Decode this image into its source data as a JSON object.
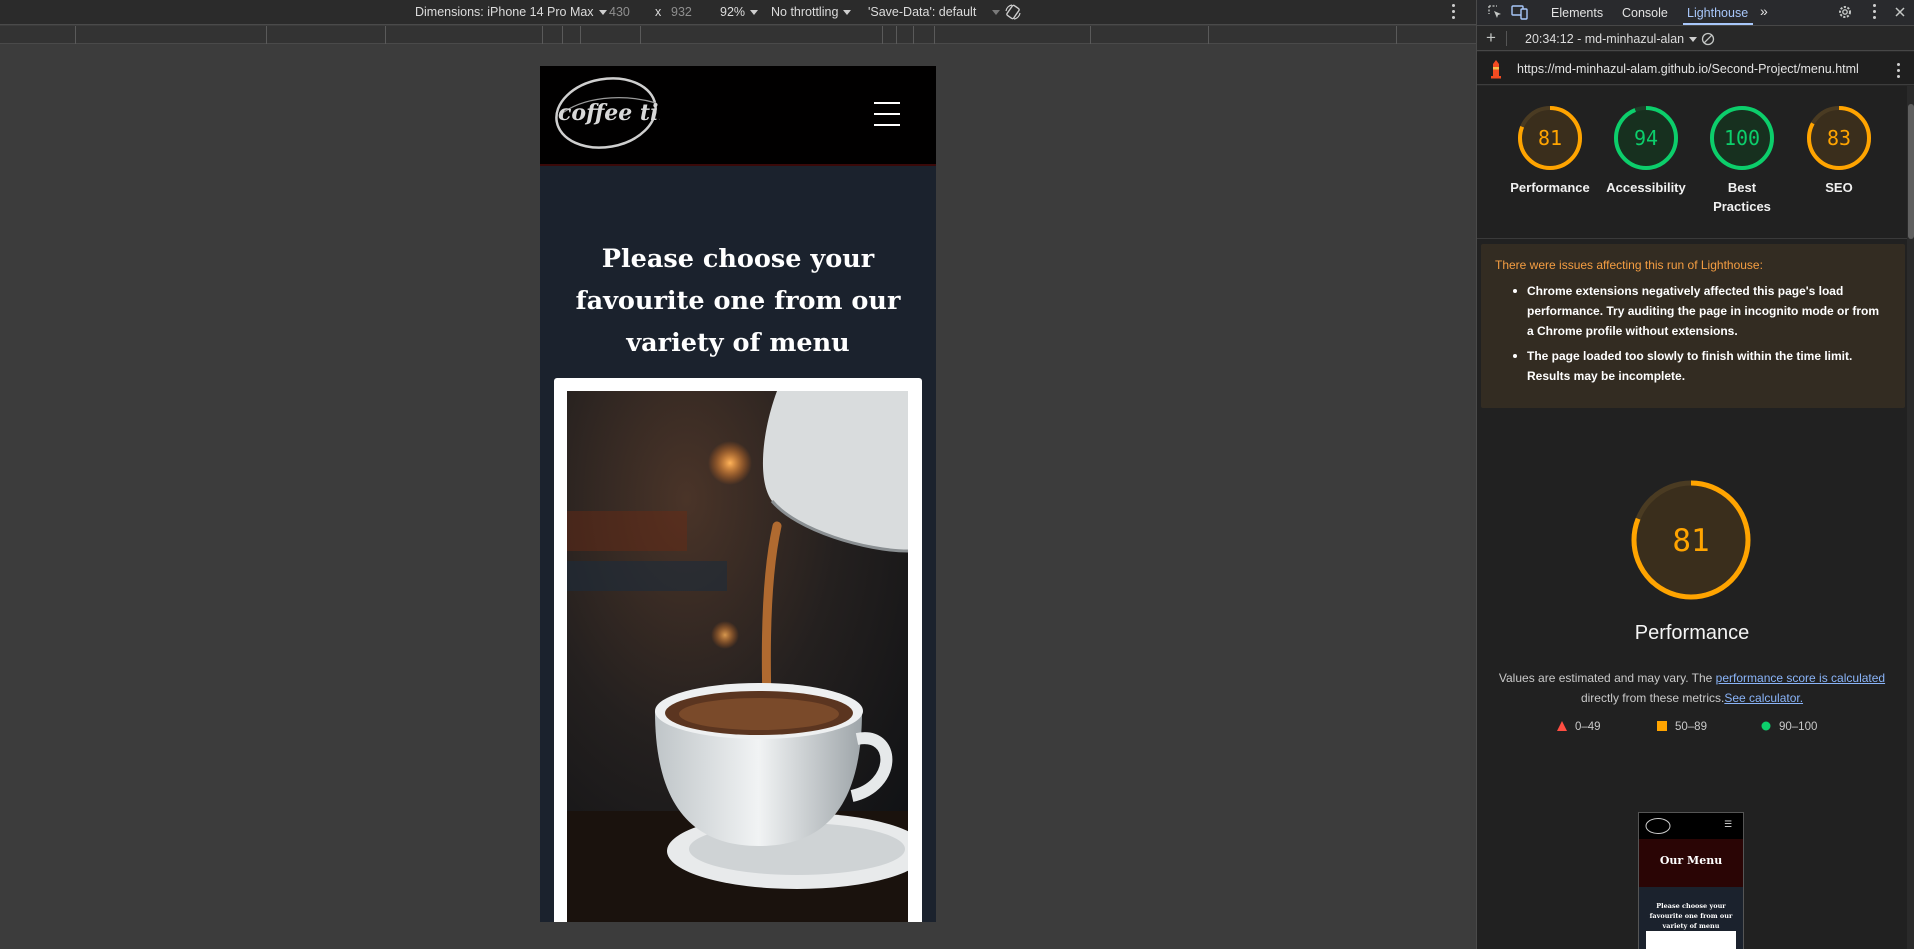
{
  "emulation_toolbar": {
    "dimensions_label": "Dimensions: iPhone 14 Pro Max",
    "width": "430",
    "times": "x",
    "height": "932",
    "zoom": "92%",
    "throttling": "No throttling",
    "save_data": "'Save-Data': default"
  },
  "site": {
    "logo_text": "coffee time",
    "hero_title": "Please choose your favourite one from our variety of menu"
  },
  "devtools": {
    "tabs": [
      "Elements",
      "Console",
      "Lighthouse"
    ],
    "active_tab": "Lighthouse",
    "report_selector": "20:34:12 - md-minhazul-alan",
    "url": "https://md-minhazul-alam.github.io/Second-Project/menu.html"
  },
  "lighthouse": {
    "scores": [
      {
        "label": "Performance",
        "value": 81,
        "color": "#ffa400"
      },
      {
        "label": "Accessibility",
        "value": 94,
        "color": "#0cce6b"
      },
      {
        "label": "Best Practices",
        "value": 100,
        "color": "#0cce6b"
      },
      {
        "label": "SEO",
        "value": 83,
        "color": "#ffa400"
      }
    ],
    "warning_title": "There were issues affecting this run of Lighthouse:",
    "warnings": [
      "Chrome extensions negatively affected this page's load performance. Try auditing the page in incognito mode or from a Chrome profile without extensions.",
      "The page loaded too slowly to finish within the time limit. Results may be incomplete."
    ],
    "main_score": {
      "label": "Performance",
      "value": 81,
      "color": "#ffa400"
    },
    "note_prefix": "Values are estimated and may vary. The ",
    "note_link": "performance score is calculated",
    "note_middle": "directly from these metrics.",
    "note_link2": "See calculator.",
    "legend": [
      {
        "range": "0–49",
        "color": "#ff4e42",
        "shape": "triangle"
      },
      {
        "range": "50–89",
        "color": "#ffa400",
        "shape": "square"
      },
      {
        "range": "90–100",
        "color": "#0cce6b",
        "shape": "circle"
      }
    ],
    "thumbnail": {
      "title": "Our Menu",
      "subtitle": "Please choose your favourite one from our variety of menu"
    }
  }
}
